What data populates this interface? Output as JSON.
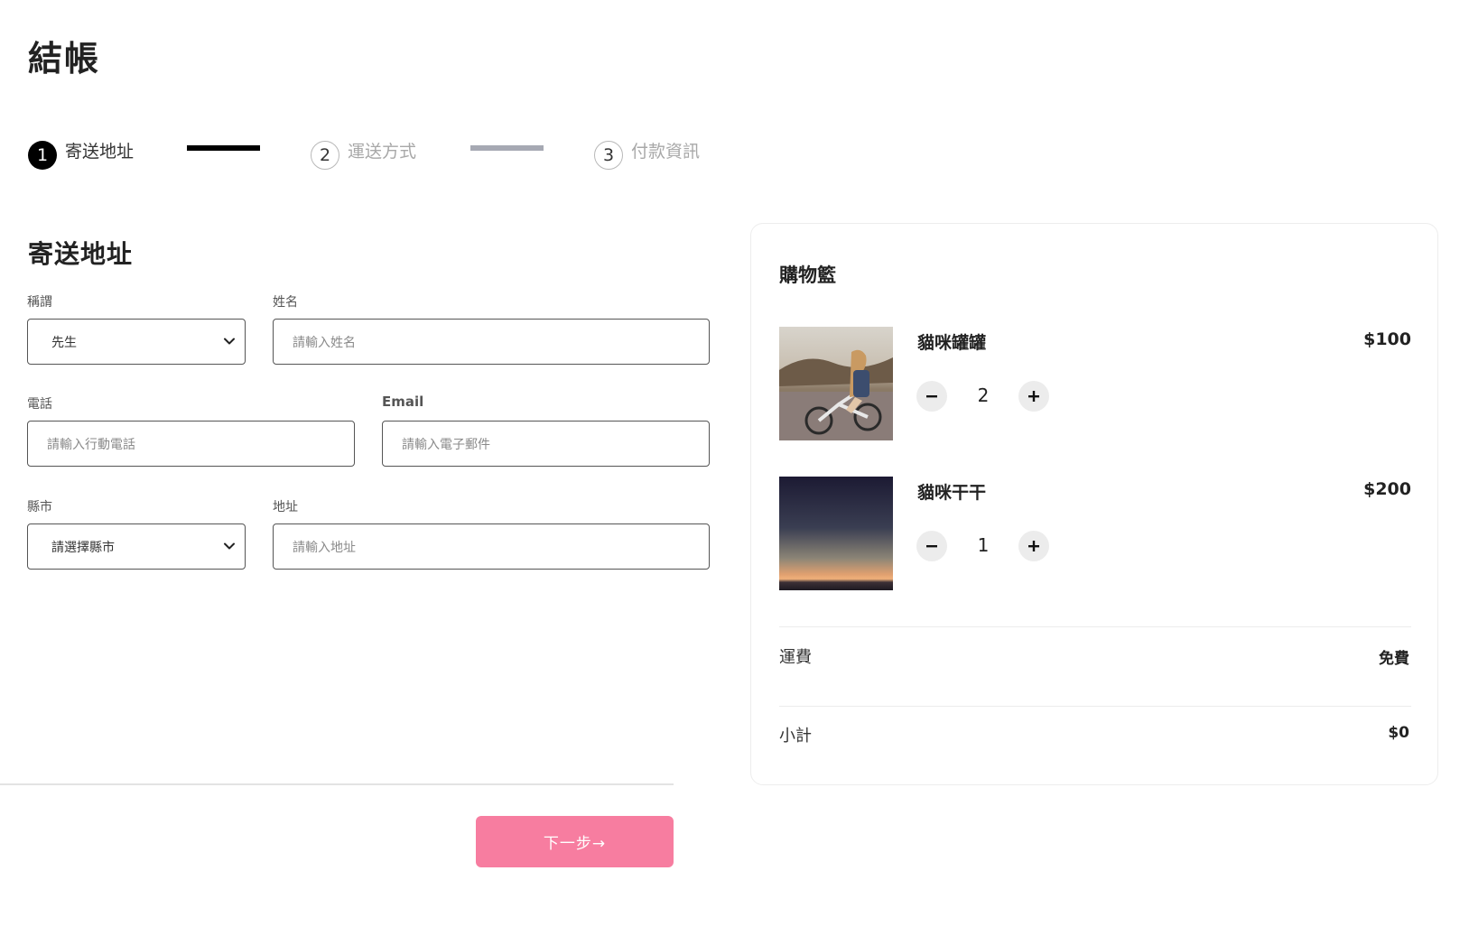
{
  "page": {
    "title": "結帳"
  },
  "stepper": {
    "steps": [
      {
        "number": "1",
        "label": "寄送地址",
        "state": "active"
      },
      {
        "number": "2",
        "label": "運送方式",
        "state": "inactive"
      },
      {
        "number": "3",
        "label": "付款資訊",
        "state": "inactive"
      }
    ]
  },
  "form": {
    "section_title": "寄送地址",
    "salutation": {
      "label": "稱謂",
      "value": "先生"
    },
    "name": {
      "label": "姓名",
      "placeholder": "請輸入姓名"
    },
    "phone": {
      "label": "電話",
      "placeholder": "請輸入行動電話"
    },
    "email": {
      "label": "Email",
      "placeholder": "請輸入電子郵件"
    },
    "city": {
      "label": "縣市",
      "value": "請選擇縣市"
    },
    "address": {
      "label": "地址",
      "placeholder": "請輸入地址"
    },
    "next_label": "下一步→"
  },
  "cart": {
    "title": "購物籃",
    "items": [
      {
        "name": "貓咪罐罐",
        "price": "$100",
        "quantity": "2",
        "image": "girl-on-bicycle-photo"
      },
      {
        "name": "貓咪干干",
        "price": "$200",
        "quantity": "1",
        "image": "sunset-sea-photo"
      }
    ],
    "shipping": {
      "label": "運費",
      "value": "免費"
    },
    "subtotal": {
      "label": "小計",
      "value": "$0"
    }
  },
  "colors": {
    "accent_pink": "#f77da0",
    "step_active": "#000000",
    "step_inactive": "#a6a9b3"
  }
}
